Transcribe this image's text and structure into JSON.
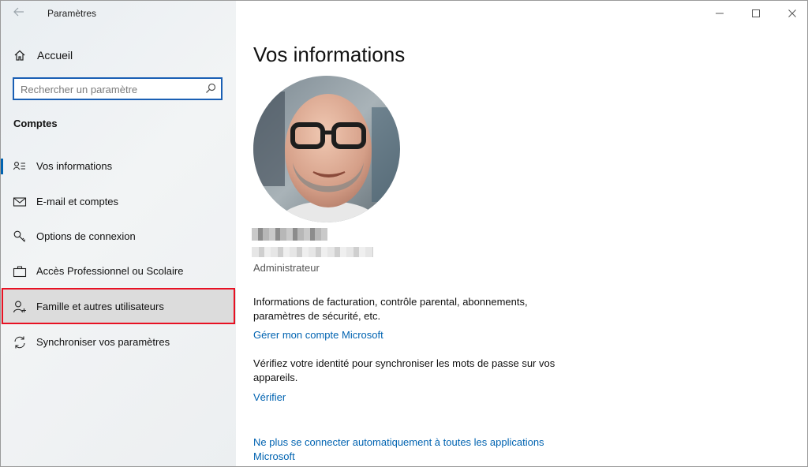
{
  "window": {
    "app_title": "Paramètres"
  },
  "sidebar": {
    "home_label": "Accueil",
    "search_placeholder": "Rechercher un paramètre",
    "section_title": "Comptes",
    "items": [
      {
        "label": "Vos informations",
        "icon": "person-card-icon",
        "selected": true
      },
      {
        "label": "E-mail et comptes",
        "icon": "mail-icon"
      },
      {
        "label": "Options de connexion",
        "icon": "key-icon"
      },
      {
        "label": "Accès Professionnel ou Scolaire",
        "icon": "briefcase-icon"
      },
      {
        "label": "Famille et autres utilisateurs",
        "icon": "person-add-icon",
        "highlighted": true
      },
      {
        "label": "Synchroniser vos paramètres",
        "icon": "sync-icon"
      }
    ]
  },
  "main": {
    "title": "Vos informations",
    "role": "Administrateur",
    "billing_text": "Informations de facturation, contrôle parental, abonnements, paramètres de sécurité, etc.",
    "manage_link": "Gérer mon compte Microsoft",
    "verify_text": "Vérifiez votre identité pour synchroniser les mots de passe sur vos appareils.",
    "verify_link": "Vérifier",
    "stop_auto_link": "Ne plus se connecter automatiquement à toutes les applications Microsoft"
  },
  "colors": {
    "accent": "#0063b1",
    "highlight_border": "#e81123",
    "search_border": "#1a5fb4"
  }
}
